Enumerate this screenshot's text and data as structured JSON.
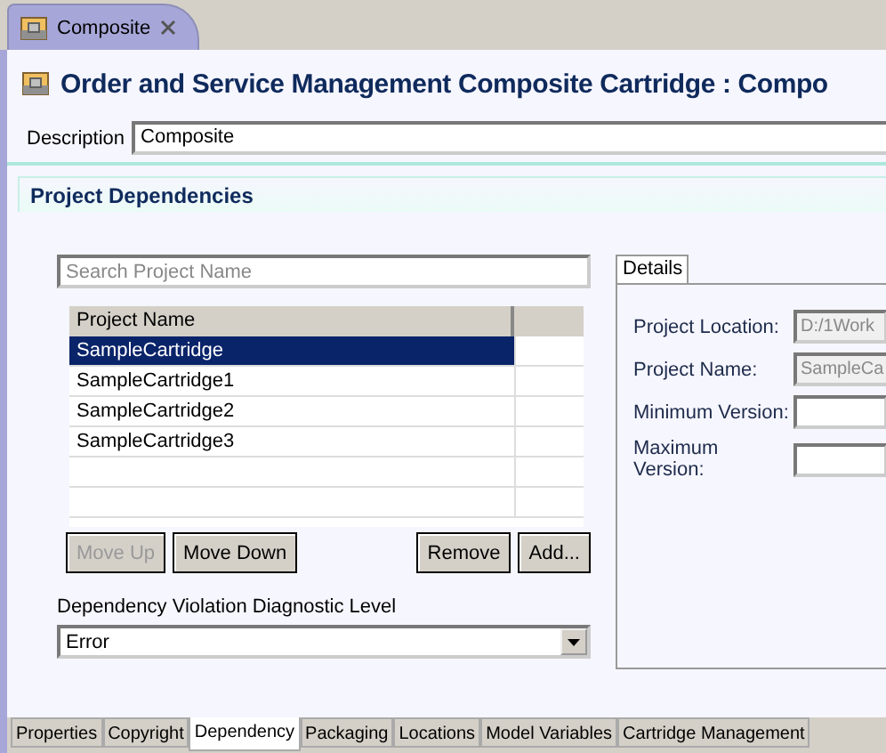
{
  "editor_tab": {
    "label": "Composite"
  },
  "title": "Order and Service Management Composite Cartridge : Compo",
  "description": {
    "label": "Description",
    "value": "Composite"
  },
  "section": {
    "title": "Project Dependencies"
  },
  "search": {
    "placeholder": "Search Project Name"
  },
  "table": {
    "columns": [
      "Project Name"
    ],
    "rows": [
      {
        "name": "SampleCartridge",
        "selected": true
      },
      {
        "name": "SampleCartridge1",
        "selected": false
      },
      {
        "name": "SampleCartridge2",
        "selected": false
      },
      {
        "name": "SampleCartridge3",
        "selected": false
      }
    ]
  },
  "buttons": [
    {
      "label": "Move Up",
      "disabled": true
    },
    {
      "label": "Move Down",
      "disabled": false
    },
    {
      "label": "Remove",
      "disabled": false
    },
    {
      "label": "Add...",
      "disabled": false
    }
  ],
  "diagnostic": {
    "label": "Dependency Violation Diagnostic Level",
    "value": "Error"
  },
  "details": {
    "tab": "Details",
    "fields": [
      {
        "label": "Project Location:",
        "value": "D:/1Work",
        "disabled": true
      },
      {
        "label": "Project Name:",
        "value": "SampleCa",
        "disabled": true
      },
      {
        "label": "Minimum Version:",
        "disabled": false
      },
      {
        "label": "Maximum Version:",
        "disabled": false
      }
    ]
  },
  "bottom_tabs": [
    {
      "label": "Properties",
      "selected": false
    },
    {
      "label": "Copyright",
      "selected": false
    },
    {
      "label": "Dependency",
      "selected": true
    },
    {
      "label": "Packaging",
      "selected": false
    },
    {
      "label": "Locations",
      "selected": false
    },
    {
      "label": "Model Variables",
      "selected": false
    },
    {
      "label": "Cartridge Management",
      "selected": false
    }
  ]
}
